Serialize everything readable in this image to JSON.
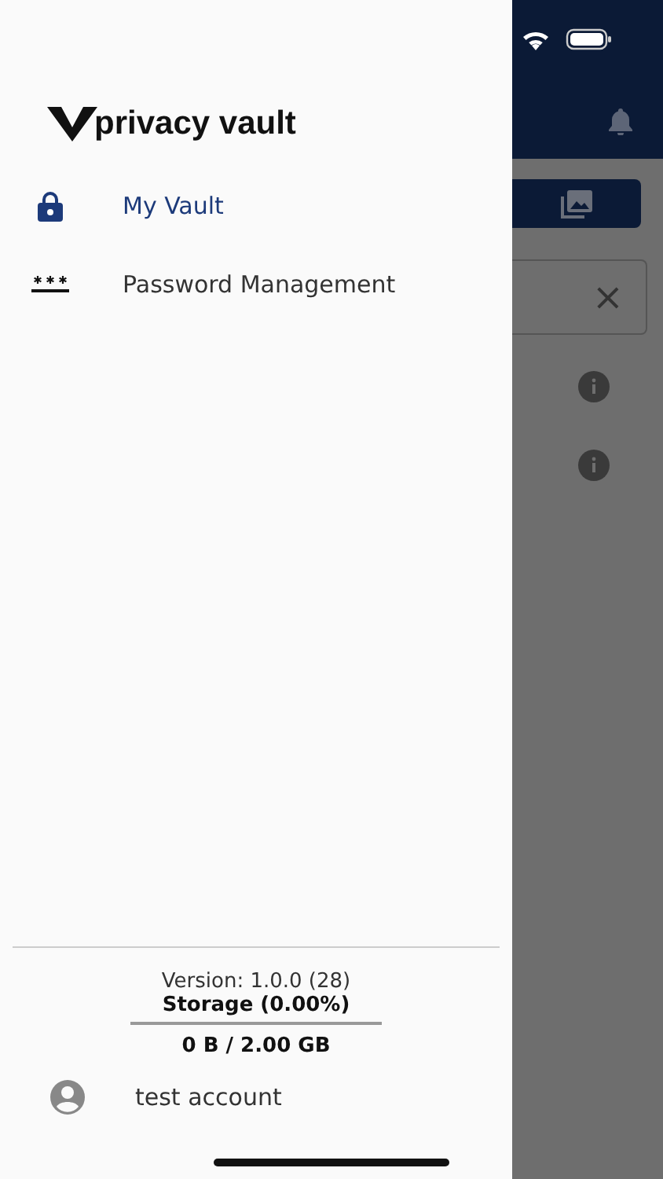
{
  "drawer": {
    "logo_text": "privacy vault",
    "menu": [
      {
        "kind": "lock",
        "label": "My Vault",
        "selected": true
      },
      {
        "kind": "password",
        "label": "Password Management",
        "selected": false
      }
    ],
    "version": "Version: 1.0.0 (28)",
    "storage_label": "Storage (0.00%)",
    "storage": {
      "level": 0
    },
    "storage_amount": "0 B / 2.00 GB",
    "account": "test account"
  },
  "background": {
    "search_clear": "×"
  }
}
